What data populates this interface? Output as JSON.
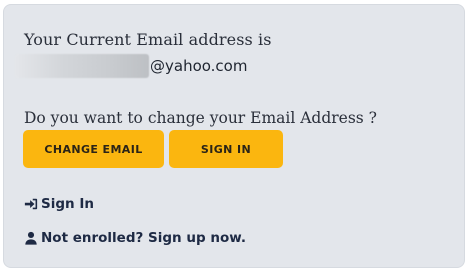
{
  "account": {
    "current_email_label": "Your Current Email address is",
    "email_domain_visible": "@yahoo.com",
    "change_prompt": "Do you want to change your Email Address ?"
  },
  "buttons": {
    "change_email": "CHANGE EMAIL",
    "sign_in": "SIGN IN"
  },
  "links": {
    "sign_in": {
      "label": "Sign In",
      "icon": "sign-in-icon"
    },
    "sign_up": {
      "label": "Not enrolled? Sign up now.",
      "icon": "user-icon"
    }
  },
  "colors": {
    "button_bg": "#fbb60f",
    "panel_bg": "#e3e6eb",
    "link_text": "#1e2a44"
  }
}
